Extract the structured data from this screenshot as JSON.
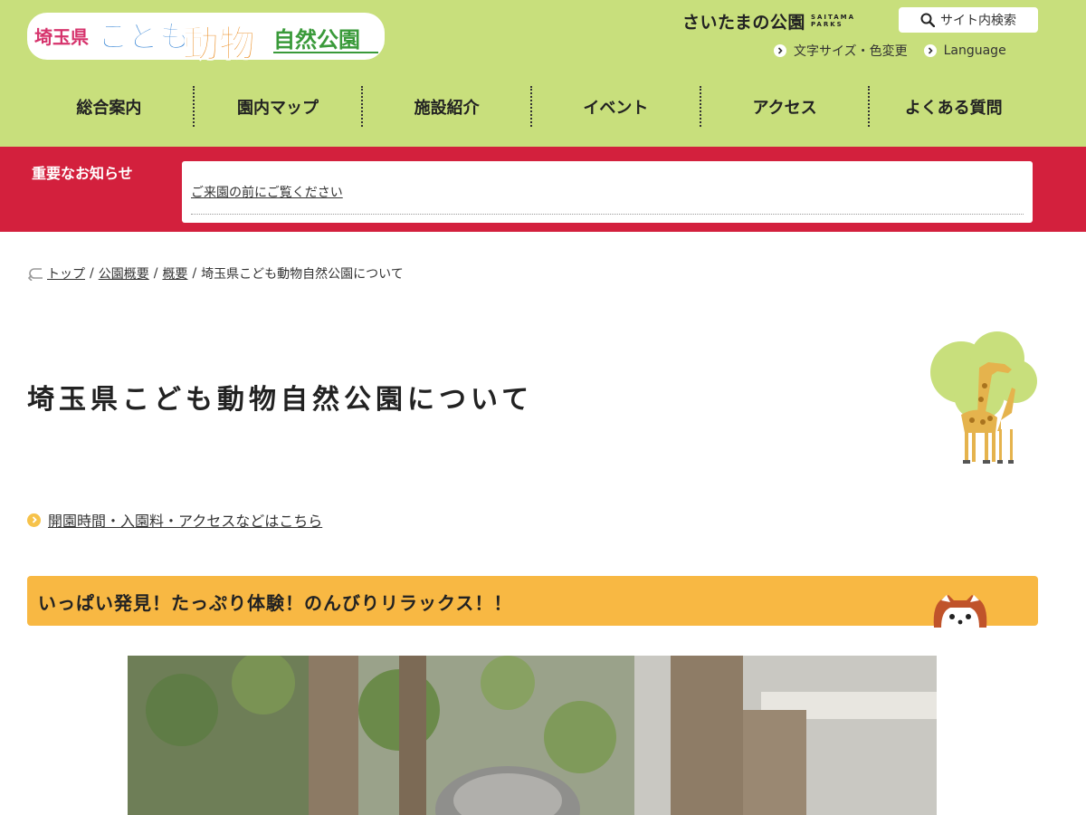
{
  "header": {
    "logo": {
      "part1": "埼玉県",
      "part2": "こども",
      "part3": "動物",
      "part4": "自然公園"
    },
    "saitama_parks": {
      "main": "さいたまの公園",
      "sub_line1": "SAITAMA",
      "sub_line2": "PARKS"
    },
    "search_label": "サイト内検索",
    "util_links": [
      {
        "label": "文字サイズ・色変更"
      },
      {
        "label": "Language"
      }
    ]
  },
  "nav": [
    {
      "label": "総合案内"
    },
    {
      "label": "園内マップ"
    },
    {
      "label": "施設紹介"
    },
    {
      "label": "イベント"
    },
    {
      "label": "アクセス"
    },
    {
      "label": "よくある質問"
    }
  ],
  "notice": {
    "title": "重要なお知らせ",
    "link": "ご来園の前にご覧ください"
  },
  "breadcrumb": {
    "items": [
      "トップ",
      "公園概要",
      "概要"
    ],
    "current": "埼玉県こども動物自然公園について",
    "separator": "/"
  },
  "page_title": "埼玉県こども動物自然公園について",
  "info_link": "開園時間・入園料・アクセスなどはこちら",
  "banner": "いっぱい発見！たっぷり体験！のんびりリラックス！！",
  "colors": {
    "header_bg": "#c8df7c",
    "notice_bg": "#d3203d",
    "banner_bg": "#f8b843",
    "bullet": "#f6c24a"
  },
  "icons": {
    "search": "search-icon",
    "chevron": "chevron-right-icon",
    "back": "return-arrow-icon"
  }
}
